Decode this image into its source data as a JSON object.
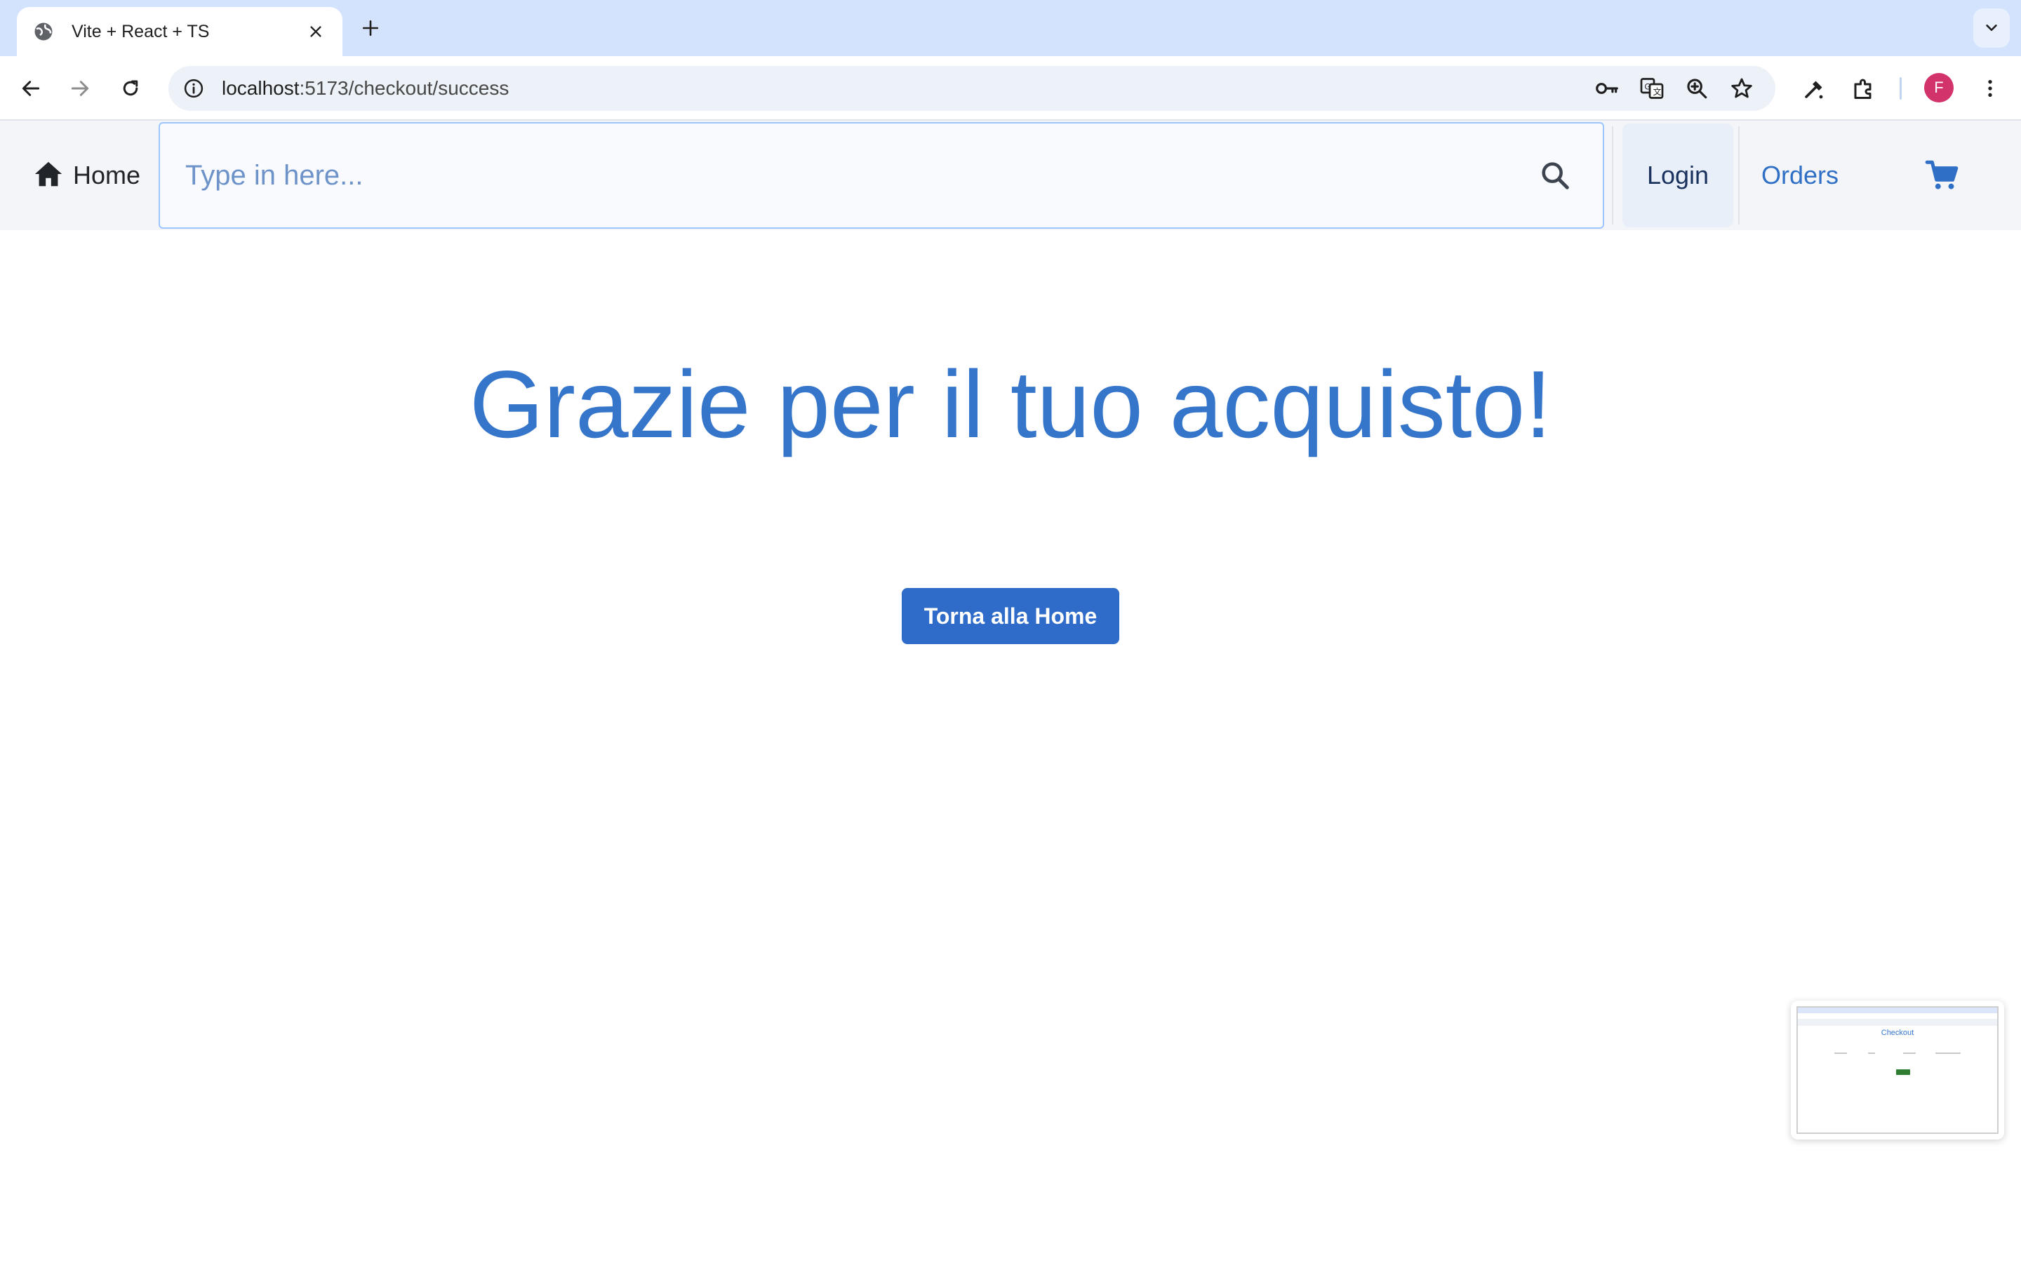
{
  "browser": {
    "tab_title": "Vite + React + TS",
    "url_host": "localhost",
    "url_path": ":5173/checkout/success",
    "profile_initial": "F"
  },
  "navbar": {
    "home_label": "Home",
    "search_placeholder": "Type in here...",
    "login_label": "Login",
    "orders_label": "Orders"
  },
  "main": {
    "title": "Grazie per il tuo acquisto!",
    "home_button_label": "Torna alla Home"
  },
  "thumbnail": {
    "title": "Checkout"
  },
  "colors": {
    "accent": "#3576cb",
    "button": "#2f6bc8",
    "tabstrip": "#d3e3fd",
    "navbar_bg": "#f3f5f8"
  }
}
